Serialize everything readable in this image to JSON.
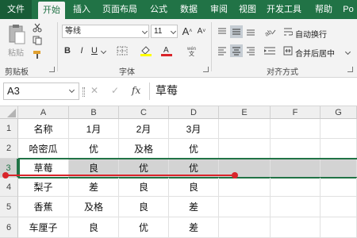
{
  "tabs": [
    "文件",
    "开始",
    "插入",
    "页面布局",
    "公式",
    "数据",
    "审阅",
    "视图",
    "开发工具",
    "帮助",
    "Po"
  ],
  "active_tab_index": 1,
  "ribbon": {
    "clipboard": {
      "paste_label": "粘贴",
      "group_label": "剪贴板"
    },
    "font": {
      "font_name": "等线",
      "font_size": "11",
      "grow_label": "A",
      "shrink_label": "A",
      "bold": "B",
      "italic": "I",
      "underline": "U",
      "group_label": "字体"
    },
    "alignment": {
      "wrap_text": "自动换行",
      "merge_center": "合并后居中",
      "group_label": "对齐方式"
    }
  },
  "formula_bar": {
    "name_box": "A3",
    "cancel": "✕",
    "enter": "✓",
    "fx": "fx",
    "content": "草莓"
  },
  "columns": [
    "A",
    "B",
    "C",
    "D",
    "E",
    "F",
    "G"
  ],
  "rows": [
    {
      "num": "1",
      "cells": [
        "名称",
        "1月",
        "2月",
        "3月"
      ]
    },
    {
      "num": "2",
      "cells": [
        "哈密瓜",
        "优",
        "及格",
        "优"
      ]
    },
    {
      "num": "3",
      "cells": [
        "草莓",
        "良",
        "优",
        "优"
      ]
    },
    {
      "num": "4",
      "cells": [
        "梨子",
        "差",
        "良",
        "良"
      ]
    },
    {
      "num": "5",
      "cells": [
        "香蕉",
        "及格",
        "良",
        "差"
      ]
    },
    {
      "num": "6",
      "cells": [
        "车厘子",
        "良",
        "优",
        "差"
      ]
    }
  ],
  "selected_row": "3",
  "colors": {
    "excel_green": "#217346",
    "annotation_red": "#d9242a",
    "selection_gray": "#d3d3d3"
  }
}
